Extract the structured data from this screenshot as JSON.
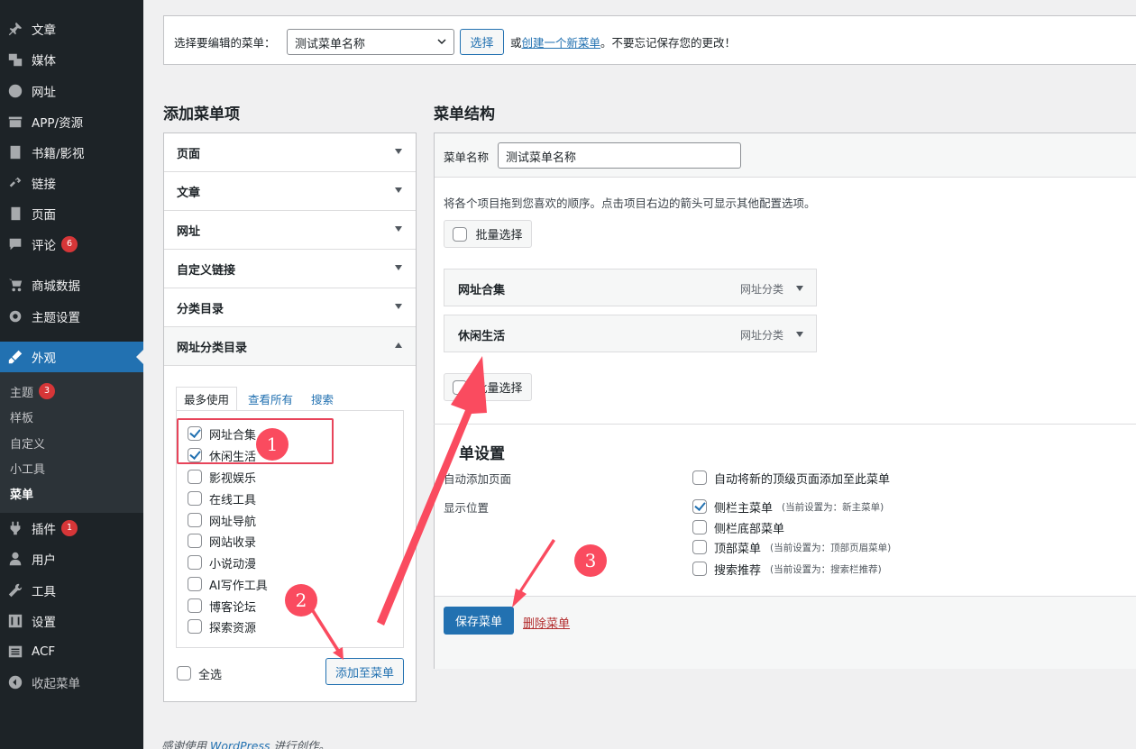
{
  "sidebar": {
    "items": [
      {
        "icon": "pin-icon",
        "label": "文章"
      },
      {
        "icon": "media-icon",
        "label": "媒体"
      },
      {
        "icon": "globe-icon",
        "label": "网址"
      },
      {
        "icon": "app-icon",
        "label": "APP/资源"
      },
      {
        "icon": "book-icon",
        "label": "书籍/影视"
      },
      {
        "icon": "link-icon",
        "label": "链接"
      },
      {
        "icon": "page-icon",
        "label": "页面"
      },
      {
        "icon": "comment-icon",
        "label": "评论",
        "badge": "6"
      },
      {
        "icon": "cart-icon",
        "label": "商城数据"
      },
      {
        "icon": "gear-icon",
        "label": "主题设置"
      },
      {
        "icon": "brush-icon",
        "label": "外观"
      },
      {
        "icon": "plugin-icon",
        "label": "插件",
        "badge": "1"
      },
      {
        "icon": "user-icon",
        "label": "用户"
      },
      {
        "icon": "wrench-icon",
        "label": "工具"
      },
      {
        "icon": "settings-icon",
        "label": "设置"
      },
      {
        "icon": "acf-icon",
        "label": "ACF"
      },
      {
        "icon": "collapse-icon",
        "label": "收起菜单"
      }
    ],
    "submenu": [
      {
        "label": "主题",
        "badge": "3"
      },
      {
        "label": "样板"
      },
      {
        "label": "自定义"
      },
      {
        "label": "小工具"
      },
      {
        "label": "菜单"
      }
    ]
  },
  "select_bar": {
    "label": "选择要编辑的菜单：",
    "selected": "测试菜单名称",
    "select_button": "选择",
    "or": "或",
    "create_link": "创建一个新菜单",
    "suffix": "。不要忘记保存您的更改！"
  },
  "add_items": {
    "heading": "添加菜单项",
    "sections": [
      "页面",
      "文章",
      "网址",
      "自定义链接",
      "分类目录",
      "网址分类目录"
    ],
    "tabs": [
      "最多使用",
      "查看所有",
      "搜索"
    ],
    "checklist": [
      {
        "label": "网址合集",
        "checked": true
      },
      {
        "label": "休闲生活",
        "checked": true
      },
      {
        "label": "影视娱乐",
        "checked": false
      },
      {
        "label": "在线工具",
        "checked": false
      },
      {
        "label": "网址导航",
        "checked": false
      },
      {
        "label": "网站收录",
        "checked": false
      },
      {
        "label": "小说动漫",
        "checked": false
      },
      {
        "label": "AI写作工具",
        "checked": false
      },
      {
        "label": "博客论坛",
        "checked": false
      },
      {
        "label": "探索资源",
        "checked": false
      }
    ],
    "select_all": "全选",
    "add_button": "添加至菜单"
  },
  "structure": {
    "heading": "菜单结构",
    "name_label": "菜单名称",
    "name_value": "测试菜单名称",
    "instructions": "将各个项目拖到您喜欢的顺序。点击项目右边的箭头可显示其他配置选项。",
    "bulk_select": "批量选择",
    "menu_items": [
      {
        "title": "网址合集",
        "type": "网址分类"
      },
      {
        "title": "休闲生活",
        "type": "网址分类"
      }
    ],
    "settings_heading": "单设置",
    "auto_add_label": "自动添加页面",
    "auto_add_option": "自动将新的顶级页面添加至此菜单",
    "location_label": "显示位置",
    "locations": [
      {
        "label": "侧栏主菜单",
        "note": "(当前设置为：新主菜单)",
        "checked": true
      },
      {
        "label": "侧栏底部菜单",
        "note": "",
        "checked": false
      },
      {
        "label": "顶部菜单",
        "note": "(当前设置为：顶部页眉菜单)",
        "checked": false
      },
      {
        "label": "搜索推荐",
        "note": "(当前设置为：搜索栏推荐)",
        "checked": false
      }
    ],
    "save_button": "保存菜单",
    "delete_link": "删除菜单"
  },
  "annotations": {
    "step1": "1",
    "step2": "2",
    "step3": "3"
  },
  "footer": {
    "prefix": "感谢使用",
    "link": "WordPress",
    "suffix": "进行创作。"
  },
  "colors": {
    "sidebar_bg": "#1d2327",
    "accent": "#2271b1",
    "annotation": "#fa4b5f",
    "badge": "#d63638"
  }
}
